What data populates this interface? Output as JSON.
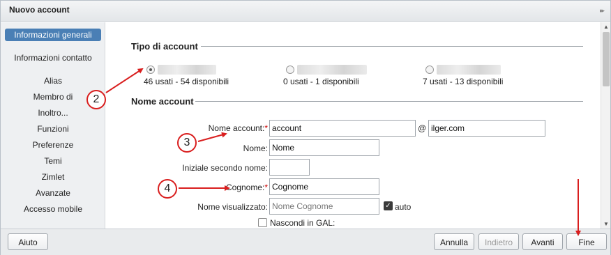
{
  "window": {
    "title": "Nuovo account",
    "collapse_icon": "double-chevron-right-icon"
  },
  "sidebar": {
    "items": [
      {
        "label": "Informazioni generali",
        "active": true
      },
      {
        "label": "Informazioni contatto"
      },
      {
        "label": "Alias"
      },
      {
        "label": "Membro di"
      },
      {
        "label": "Inoltro..."
      },
      {
        "label": "Funzioni"
      },
      {
        "label": "Preferenze"
      },
      {
        "label": "Temi"
      },
      {
        "label": "Zimlet"
      },
      {
        "label": "Avanzate"
      },
      {
        "label": "Accesso mobile"
      }
    ]
  },
  "account_type": {
    "section_title": "Tipo di account",
    "options": [
      {
        "usage": "46 usati - 54 disponibili",
        "selected": true
      },
      {
        "usage": "0 usati - 1 disponibili",
        "selected": false
      },
      {
        "usage": "7 usati - 13 disponibili",
        "selected": false
      }
    ]
  },
  "account_name": {
    "section_title": "Nome account",
    "account_label": "Nome account:",
    "account_value": "account",
    "at": "@",
    "domain_value": "ilger.com",
    "name_label": "Nome:",
    "name_value": "Nome",
    "middle_label": "Iniziale secondo nome:",
    "middle_value": "",
    "surname_label": "Cognome:",
    "surname_value": "Cognome",
    "display_label": "Nome visualizzato:",
    "display_value": "Nome Cognome",
    "auto_label": "auto",
    "auto_checked": true,
    "hide_gal_label": "Nascondi in GAL:",
    "hide_gal_checked": false,
    "required_mark": "*"
  },
  "footer": {
    "help": "Aiuto",
    "cancel": "Annulla",
    "back": "Indietro",
    "next": "Avanti",
    "finish": "Fine"
  },
  "annotations": {
    "step2": "2",
    "step3": "3",
    "step4": "4",
    "color": "#d91e1e"
  }
}
